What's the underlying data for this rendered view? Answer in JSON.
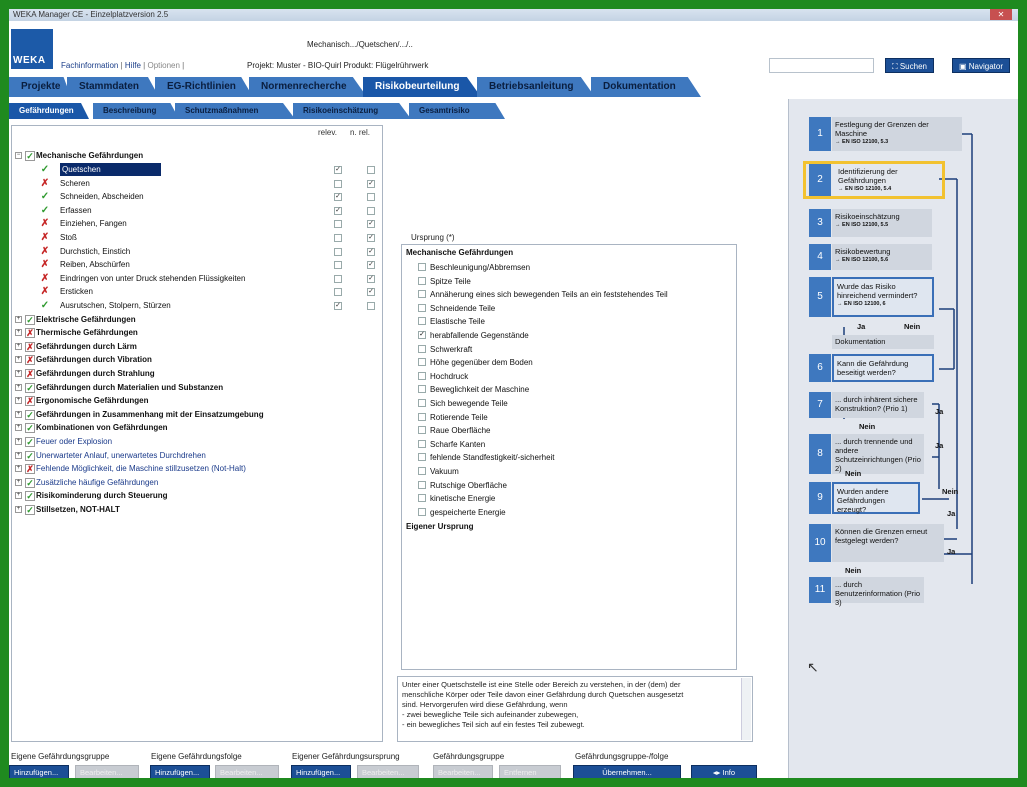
{
  "window": {
    "title": "WEKA Manager CE - Einzelplatzversion 2.5",
    "close": "✕"
  },
  "header": {
    "logo": "WEKA",
    "path": "Mechanisch.../Quetschen/.../..",
    "links": [
      "Fachinformation",
      "Hilfe",
      "Optionen"
    ],
    "project": "Projekt: Muster - BIO-Quirl Produkt: Flügelrührwerk",
    "search_label": "Suchen",
    "navigator_label": "Navigator"
  },
  "main_tabs": [
    "Projekte",
    "Stammdaten",
    "EG-Richtlinien",
    "Normenrecherche",
    "Risikobeurteilung",
    "Betriebsanleitung",
    "Dokumentation"
  ],
  "sub_tabs": [
    "Gefährdungen",
    "Beschreibung",
    "Schutzmaßnahmen",
    "Risikoeinschätzung",
    "Gesamtrisiko"
  ],
  "tree": {
    "col_relev": "relev.",
    "col_nrel": "n. rel.",
    "root": "Mechanische Gefährdungen",
    "items": [
      {
        "label": "Quetschen",
        "status": "ok",
        "relev": true,
        "nrel": false,
        "selected": true
      },
      {
        "label": "Scheren",
        "status": "no",
        "relev": false,
        "nrel": true
      },
      {
        "label": "Schneiden, Abscheiden",
        "status": "ok",
        "relev": true,
        "nrel": false
      },
      {
        "label": "Erfassen",
        "status": "ok",
        "relev": true,
        "nrel": false
      },
      {
        "label": "Einziehen, Fangen",
        "status": "no",
        "relev": false,
        "nrel": true
      },
      {
        "label": "Stoß",
        "status": "no",
        "relev": false,
        "nrel": true
      },
      {
        "label": "Durchstich, Einstich",
        "status": "no",
        "relev": false,
        "nrel": true
      },
      {
        "label": "Reiben, Abschürfen",
        "status": "no",
        "relev": false,
        "nrel": true
      },
      {
        "label": "Eindringen von unter Druck stehenden Flüssigkeiten",
        "status": "no",
        "relev": false,
        "nrel": true
      },
      {
        "label": "Ersticken",
        "status": "no",
        "relev": false,
        "nrel": true
      },
      {
        "label": "Ausrutschen, Stolpern, Stürzen",
        "status": "ok",
        "relev": true,
        "nrel": false
      }
    ],
    "categories": [
      {
        "label": "Elektrische Gefährdungen",
        "status": "ok",
        "bold": true
      },
      {
        "label": "Thermische Gefährdungen",
        "status": "no",
        "bold": true
      },
      {
        "label": "Gefährdungen durch Lärm",
        "status": "no",
        "bold": true
      },
      {
        "label": "Gefährdungen durch Vibration",
        "status": "no",
        "bold": true
      },
      {
        "label": "Gefährdungen durch Strahlung",
        "status": "no",
        "bold": true
      },
      {
        "label": "Gefährdungen durch Materialien und Substanzen",
        "status": "ok",
        "bold": true
      },
      {
        "label": "Ergonomische Gefährdungen",
        "status": "no",
        "bold": true
      },
      {
        "label": "Gefährdungen in Zusammenhang mit der Einsatzumgebung",
        "status": "ok",
        "bold": true
      },
      {
        "label": "Kombinationen von Gefährdungen",
        "status": "ok",
        "bold": true
      },
      {
        "label": "Feuer oder Explosion",
        "status": "ok",
        "bold": false
      },
      {
        "label": "Unerwarteter Anlauf, unerwartetes Durchdrehen",
        "status": "ok",
        "bold": false
      },
      {
        "label": "Fehlende Möglichkeit, die Maschine stillzusetzen (Not-Halt)",
        "status": "no",
        "bold": false
      },
      {
        "label": "Zusätzliche häufige Gefährdungen",
        "status": "ok",
        "bold": false
      },
      {
        "label": "Risikominderung durch Steuerung",
        "status": "ok",
        "bold": true
      },
      {
        "label": "Stillsetzen, NOT-HALT",
        "status": "ok",
        "bold": true
      }
    ]
  },
  "ursprung": {
    "title": "Ursprung (*)",
    "head": "Mechanische Gefährdungen",
    "items": [
      {
        "label": "Beschleunigung/Abbremsen",
        "checked": false
      },
      {
        "label": "Spitze Teile",
        "checked": false
      },
      {
        "label": "Annäherung eines sich bewegenden Teils an ein feststehendes Teil",
        "checked": false
      },
      {
        "label": "Schneidende Teile",
        "checked": false
      },
      {
        "label": "Elastische Teile",
        "checked": false
      },
      {
        "label": "herabfallende Gegenstände",
        "checked": true
      },
      {
        "label": "Schwerkraft",
        "checked": false
      },
      {
        "label": "Höhe gegenüber dem Boden",
        "checked": false
      },
      {
        "label": "Hochdruck",
        "checked": false
      },
      {
        "label": "Beweglichkeit der Maschine",
        "checked": false
      },
      {
        "label": "Sich bewegende Teile",
        "checked": false
      },
      {
        "label": "Rotierende Teile",
        "checked": false
      },
      {
        "label": "Raue Oberfläche",
        "checked": false
      },
      {
        "label": "Scharfe Kanten",
        "checked": false
      },
      {
        "label": "fehlende Standfestigkeit/-sicherheit",
        "checked": false
      },
      {
        "label": "Vakuum",
        "checked": false
      },
      {
        "label": "Rutschige Oberfläche",
        "checked": false
      },
      {
        "label": "kinetische Energie",
        "checked": false
      },
      {
        "label": "gespeicherte Energie",
        "checked": false
      }
    ],
    "own": "Eigener Ursprung"
  },
  "description": [
    "Unter einer Quetschstelle ist eine Stelle oder Bereich zu verstehen, in der (dem) der",
    "menschliche Körper oder Teile davon einer Gefährdung durch Quetschen ausgesetzt",
    "sind. Hervorgerufen wird diese Gefährdung, wenn",
    "- zwei bewegliche Teile sich aufeinander zubewegen,",
    "- ein bewegliches Teil sich auf ein festes Teil zubewegt."
  ],
  "bottom": {
    "groups": [
      "Eigene Gefährdungsgruppe",
      "Eigene Gefährdungsfolge",
      "Eigener Gefährdungsursprung",
      "Gefährdungsgruppe",
      "Gefährdungsgruppe-/folge"
    ],
    "add": "Hinzufügen...",
    "edit": "Bearbeiten...",
    "delete": "Entfernen",
    "take_over": "Übernehmen...",
    "info": "Info"
  },
  "flow": {
    "steps": [
      {
        "num": "1",
        "text": "Festlegung der Grenzen der Maschine",
        "ref": "→ EN ISO 12100, 5.3"
      },
      {
        "num": "2",
        "text": "Identifizierung der Gefährdungen",
        "ref": "→ EN ISO 12100, 5.4"
      },
      {
        "num": "3",
        "text": "Risikoeinschätzung",
        "ref": "→ EN ISO 12100, 5.5"
      },
      {
        "num": "4",
        "text": "Risikobewertung",
        "ref": "→ EN ISO 12100, 5.6"
      },
      {
        "num": "5",
        "text": "Wurde das Risiko hinreichend vermindert?",
        "ref": "→ EN ISO 12100, 6"
      },
      {
        "num": "6",
        "text": "Kann die Gefährdung beseitigt werden?",
        "ref": ""
      },
      {
        "num": "7",
        "text": "... durch inhärent sichere Konstruktion? (Prio 1)",
        "ref": ""
      },
      {
        "num": "8",
        "text": "... durch trennende und andere Schutzeinrichtungen (Prio 2)",
        "ref": ""
      },
      {
        "num": "9",
        "text": "Wurden andere Gefährdungen erzeugt?",
        "ref": ""
      },
      {
        "num": "10",
        "text": "Können die Grenzen erneut festgelegt werden?",
        "ref": ""
      },
      {
        "num": "11",
        "text": "... durch Benutzerinformation (Prio 3)",
        "ref": ""
      }
    ],
    "doc_label": "Dokumentation",
    "ja": "Ja",
    "nein": "Nein"
  },
  "colors": {
    "accent": "#1a57a8",
    "tab": "#3e78bf",
    "highlight": "#f2c230",
    "frame": "#1f8a1f"
  }
}
